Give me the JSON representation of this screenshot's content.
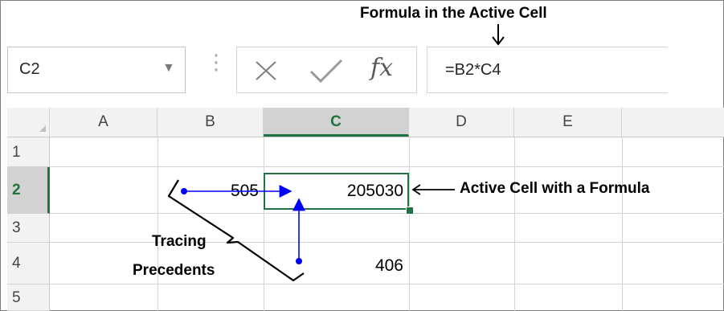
{
  "annotations": {
    "formula_label": "Formula in the Active Cell",
    "active_cell_label": "Active Cell with a Formula",
    "tracing_line1": "Tracing",
    "tracing_line2": "Precedents"
  },
  "formula_bar": {
    "name_box": "C2",
    "fx_symbol": "fx",
    "formula": "=B2*C4"
  },
  "sheet": {
    "columns": [
      "A",
      "B",
      "C",
      "D",
      "E"
    ],
    "active_column": "C",
    "rows": [
      "1",
      "2",
      "3",
      "4",
      "5"
    ],
    "active_row": "2",
    "cells": {
      "B2": "505",
      "C2": "205030",
      "C4": "406"
    }
  },
  "colors": {
    "active_green": "#217346",
    "arrow_blue": "#0000ff"
  }
}
